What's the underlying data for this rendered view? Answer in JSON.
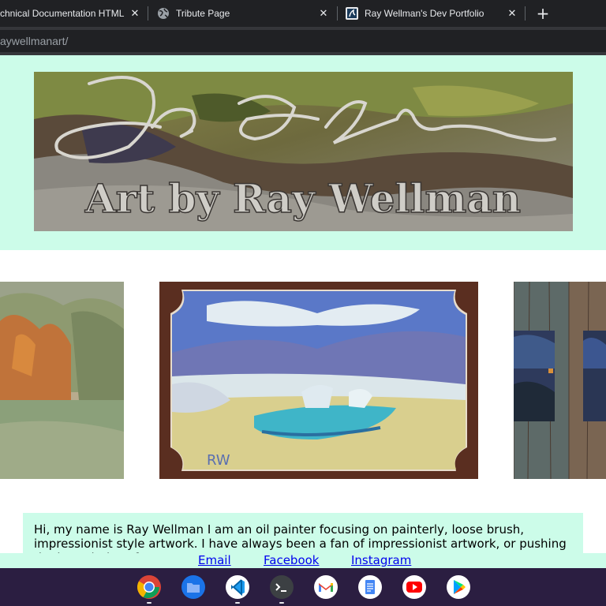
{
  "browser": {
    "tabs": [
      {
        "title": "chnical Documentation HTML",
        "close": "✕"
      },
      {
        "title": "Tribute Page",
        "close": "✕"
      },
      {
        "title": "Ray Wellman's Dev Portfolio",
        "close": "✕"
      }
    ],
    "new_tab": "+",
    "url": "aywellmanart/"
  },
  "banner": {
    "title": "Art by Ray Wellman",
    "signature": "Ray Wellman"
  },
  "about": {
    "text": "Hi, my name is Ray Wellman I am an oil painter focusing on painterly, loose brush, impressionist style artwork. I have always been a fan of impressionist artwork, or pushing the boundaries of"
  },
  "footer": {
    "links": [
      {
        "label": "Email"
      },
      {
        "label": "Facebook"
      },
      {
        "label": "Instagram"
      }
    ]
  },
  "shelf": {
    "apps": [
      "Chrome",
      "Files",
      "Visual Studio Code",
      "Terminal",
      "Gmail",
      "Docs",
      "YouTube",
      "Play Store"
    ]
  },
  "colors": {
    "page_accent": "#ccfce9",
    "link": "#0000ee",
    "shelf": "#2b1e41"
  }
}
